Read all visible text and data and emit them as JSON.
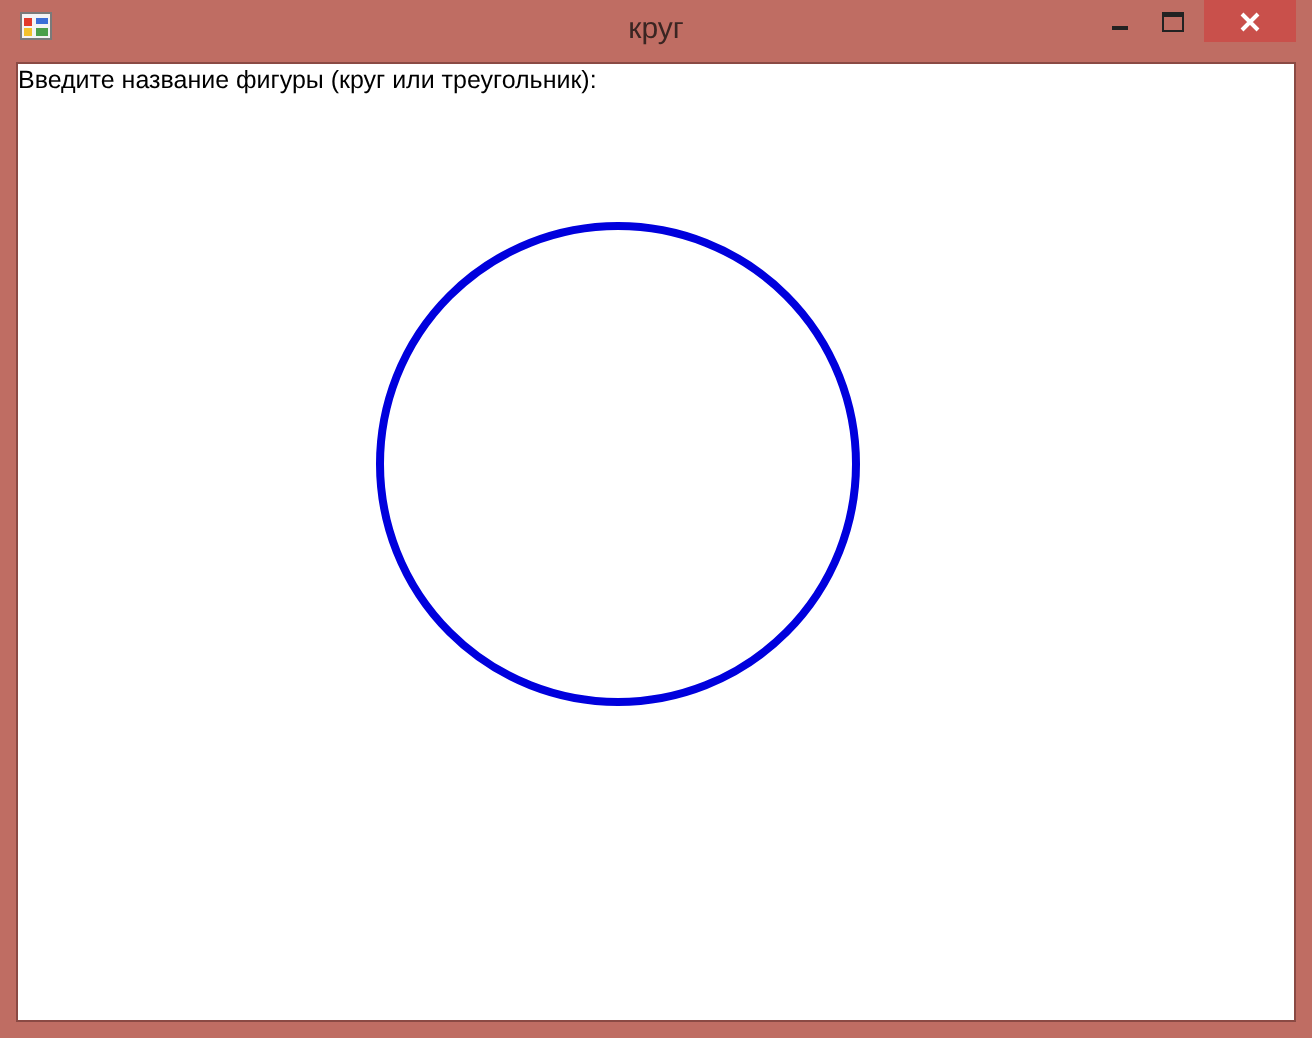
{
  "window": {
    "title": "круг"
  },
  "prompt_label": "Введите название фигуры (круг или треугольник):",
  "shape": {
    "kind": "circle"
  }
}
